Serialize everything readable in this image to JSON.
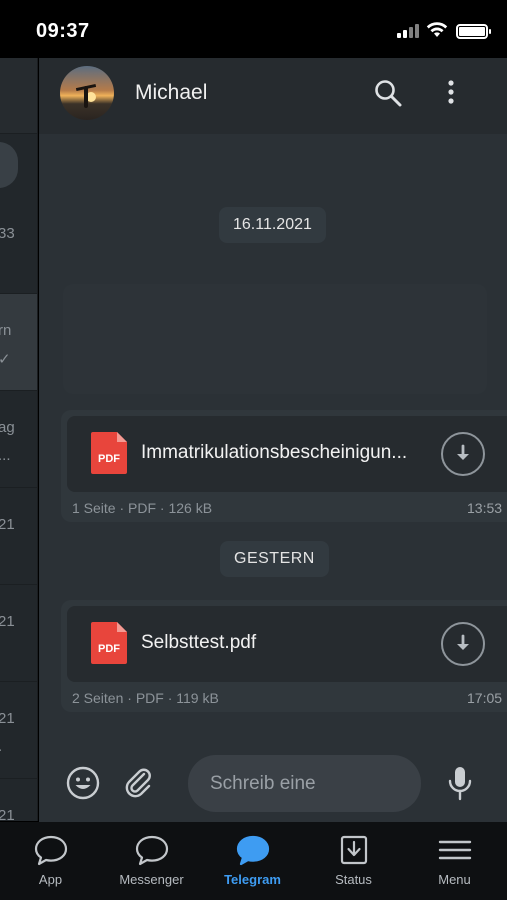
{
  "status_bar": {
    "time": "09:37"
  },
  "chat_list_partial": {
    "rows": [
      {
        "line1": "33",
        "line2": ""
      },
      {
        "line1": "rn",
        "line2": "✓"
      },
      {
        "line1": "ag",
        "line2": "..."
      },
      {
        "line1": "21",
        "line2": ""
      },
      {
        "line1": "21",
        "line2": ""
      },
      {
        "line1": "21",
        "line2": "."
      },
      {
        "line1": "21",
        "line2": ""
      }
    ]
  },
  "header": {
    "contact_name": "Michael"
  },
  "chat": {
    "date_divider": "16.11.2021",
    "messages": [
      {
        "file_icon": "PDF",
        "file_name": "Immatrikulationsbescheinigun...",
        "meta": "1 Seite · PDF · 126 kB",
        "time": "13:53"
      },
      {
        "day_divider": "GESTERN",
        "file_icon": "PDF",
        "file_name": "Selbsttest.pdf",
        "meta": "2 Seiten · PDF · 119 kB",
        "time": "17:05"
      }
    ]
  },
  "input": {
    "placeholder": "Schreib eine"
  },
  "tabbar": {
    "tabs": [
      {
        "label": "App",
        "icon": "chat-bubble-icon",
        "active": false
      },
      {
        "label": "Messenger",
        "icon": "chat-bubble-icon",
        "active": false
      },
      {
        "label": "Telegram",
        "icon": "chat-bubble-filled-icon",
        "active": true
      },
      {
        "label": "Status",
        "icon": "download-box-icon",
        "active": false
      },
      {
        "label": "Menu",
        "icon": "hamburger-icon",
        "active": false
      }
    ]
  },
  "colors": {
    "accent": "#3e9cf2",
    "pdf_red": "#e8453c",
    "background": "#2b3136"
  }
}
